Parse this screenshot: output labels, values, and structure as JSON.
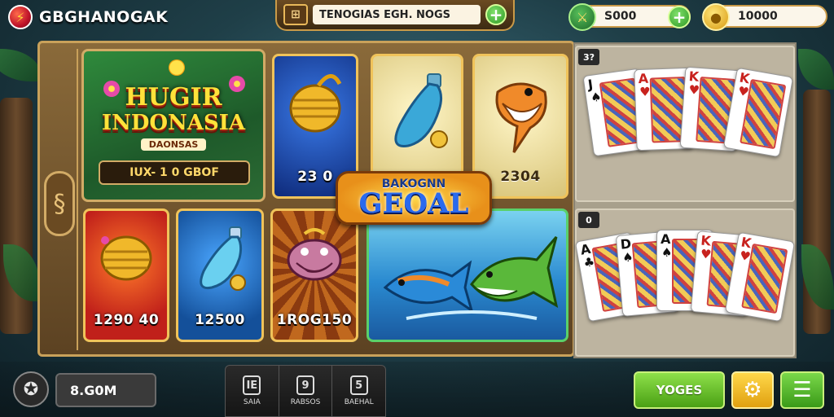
{
  "header": {
    "brand_name": "GBGHANOGAK",
    "brand_icon": "game-logo-icon",
    "search_icon": "gem-frame-icon",
    "search_value": "TENOGIAS EGH. NOGS",
    "currency_1_value": "S000",
    "currency_2_value": "10000",
    "currency_1_icon": "energy-orb-icon",
    "currency_2_icon": "gold-coin-icon"
  },
  "tiles": {
    "main": {
      "title_line1": "HUGIR",
      "title_line2": "INDONASIA",
      "subtitle": "DAONSAS",
      "bar_text": "IUX- 1 0 GBOF"
    },
    "blue_coins": {
      "value": "23 0",
      "icon": "coin-pot-icon"
    },
    "cream_flask": {
      "value": "",
      "icon": "fish-bottle-icon"
    },
    "cream_fish": {
      "value": "2304",
      "icon": "orange-fish-icon"
    },
    "red_coins": {
      "value": "1290 40",
      "icon": "coin-pot-icon"
    },
    "blue_flask": {
      "value": "12500",
      "icon": "fish-bottle-icon"
    },
    "brown_fish": {
      "value": "1ROG150",
      "icon": "catfish-icon"
    },
    "fish_banner": {
      "icon": "fish-pair-icon"
    }
  },
  "badge": {
    "top_text": "BAKOGNN",
    "main_text": "GEOAL"
  },
  "cards": {
    "box1_tag": "3?",
    "box2_tag": "0",
    "row1": [
      {
        "rank": "J",
        "suit": "♠",
        "color": "#111111"
      },
      {
        "rank": "A",
        "suit": "♥",
        "color": "#c8221e"
      },
      {
        "rank": "K",
        "suit": "♥",
        "color": "#c8221e"
      },
      {
        "rank": "K",
        "suit": "♥",
        "color": "#c8221e"
      }
    ],
    "row2": [
      {
        "rank": "A",
        "suit": "♣",
        "color": "#111111"
      },
      {
        "rank": "D",
        "suit": "♠",
        "color": "#111111"
      },
      {
        "rank": "A",
        "suit": "♠",
        "color": "#111111"
      },
      {
        "rank": "K",
        "suit": "♥",
        "color": "#c8221e"
      },
      {
        "rank": "K",
        "suit": "♥",
        "color": "#c8221e"
      }
    ]
  },
  "footer": {
    "profile_icon": "profile-badge-icon",
    "balance": "8.G0M",
    "nav": [
      {
        "icon_glyph": "IE",
        "label": "SAIA",
        "icon": "stats-icon"
      },
      {
        "icon_glyph": "9",
        "label": "RABSOS",
        "icon": "bag-icon"
      },
      {
        "icon_glyph": "5",
        "label": "BAEHAL",
        "icon": "flag-icon"
      }
    ],
    "primary_button": "YOGES",
    "settings_icon": "gear-icon",
    "menu_icon": "menu-icon"
  },
  "colors": {
    "accent_gold": "#f0c35a",
    "board_wood": "#8a6a3a",
    "button_green": "#4aa014",
    "button_yellow": "#e0a010"
  }
}
